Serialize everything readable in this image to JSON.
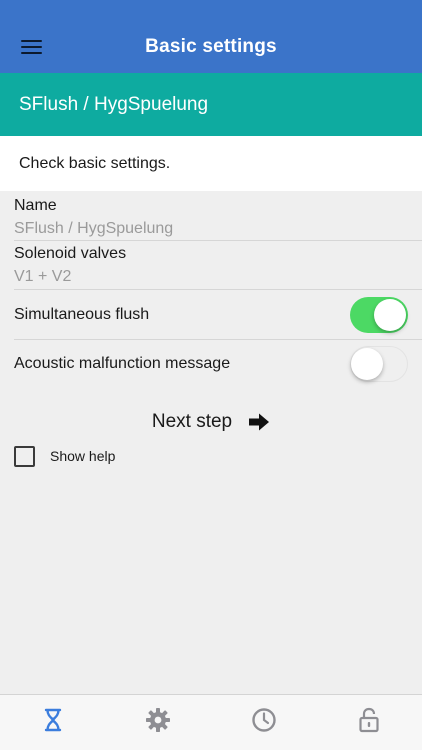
{
  "header": {
    "title": "Basic settings",
    "menu_icon": "hamburger-menu-icon"
  },
  "subheader": {
    "title": "SFlush / HygSpuelung"
  },
  "intro": {
    "text": "Check basic settings."
  },
  "fields": [
    {
      "label": "Name",
      "value": "SFlush / HygSpuelung"
    },
    {
      "label": "Solenoid valves",
      "value": "V1 + V2"
    }
  ],
  "toggles": [
    {
      "label": "Simultaneous flush",
      "on": true
    },
    {
      "label": "Acoustic malfunction message",
      "on": false
    }
  ],
  "next_step": {
    "label": "Next step",
    "icon": "arrow-right-icon"
  },
  "help": {
    "label": "Show help",
    "checked": false
  },
  "tabbar": {
    "tabs": [
      {
        "icon": "hourglass-icon",
        "active": true
      },
      {
        "icon": "gear-icon",
        "active": false
      },
      {
        "icon": "clock-icon",
        "active": false
      },
      {
        "icon": "lock-icon",
        "active": false
      }
    ],
    "active_color": "#3b7ddd",
    "inactive_color": "#8e8e93"
  },
  "colors": {
    "header_bg": "#3b74c9",
    "subheader_bg": "#0eaba0",
    "toggle_on": "#4cd964"
  }
}
